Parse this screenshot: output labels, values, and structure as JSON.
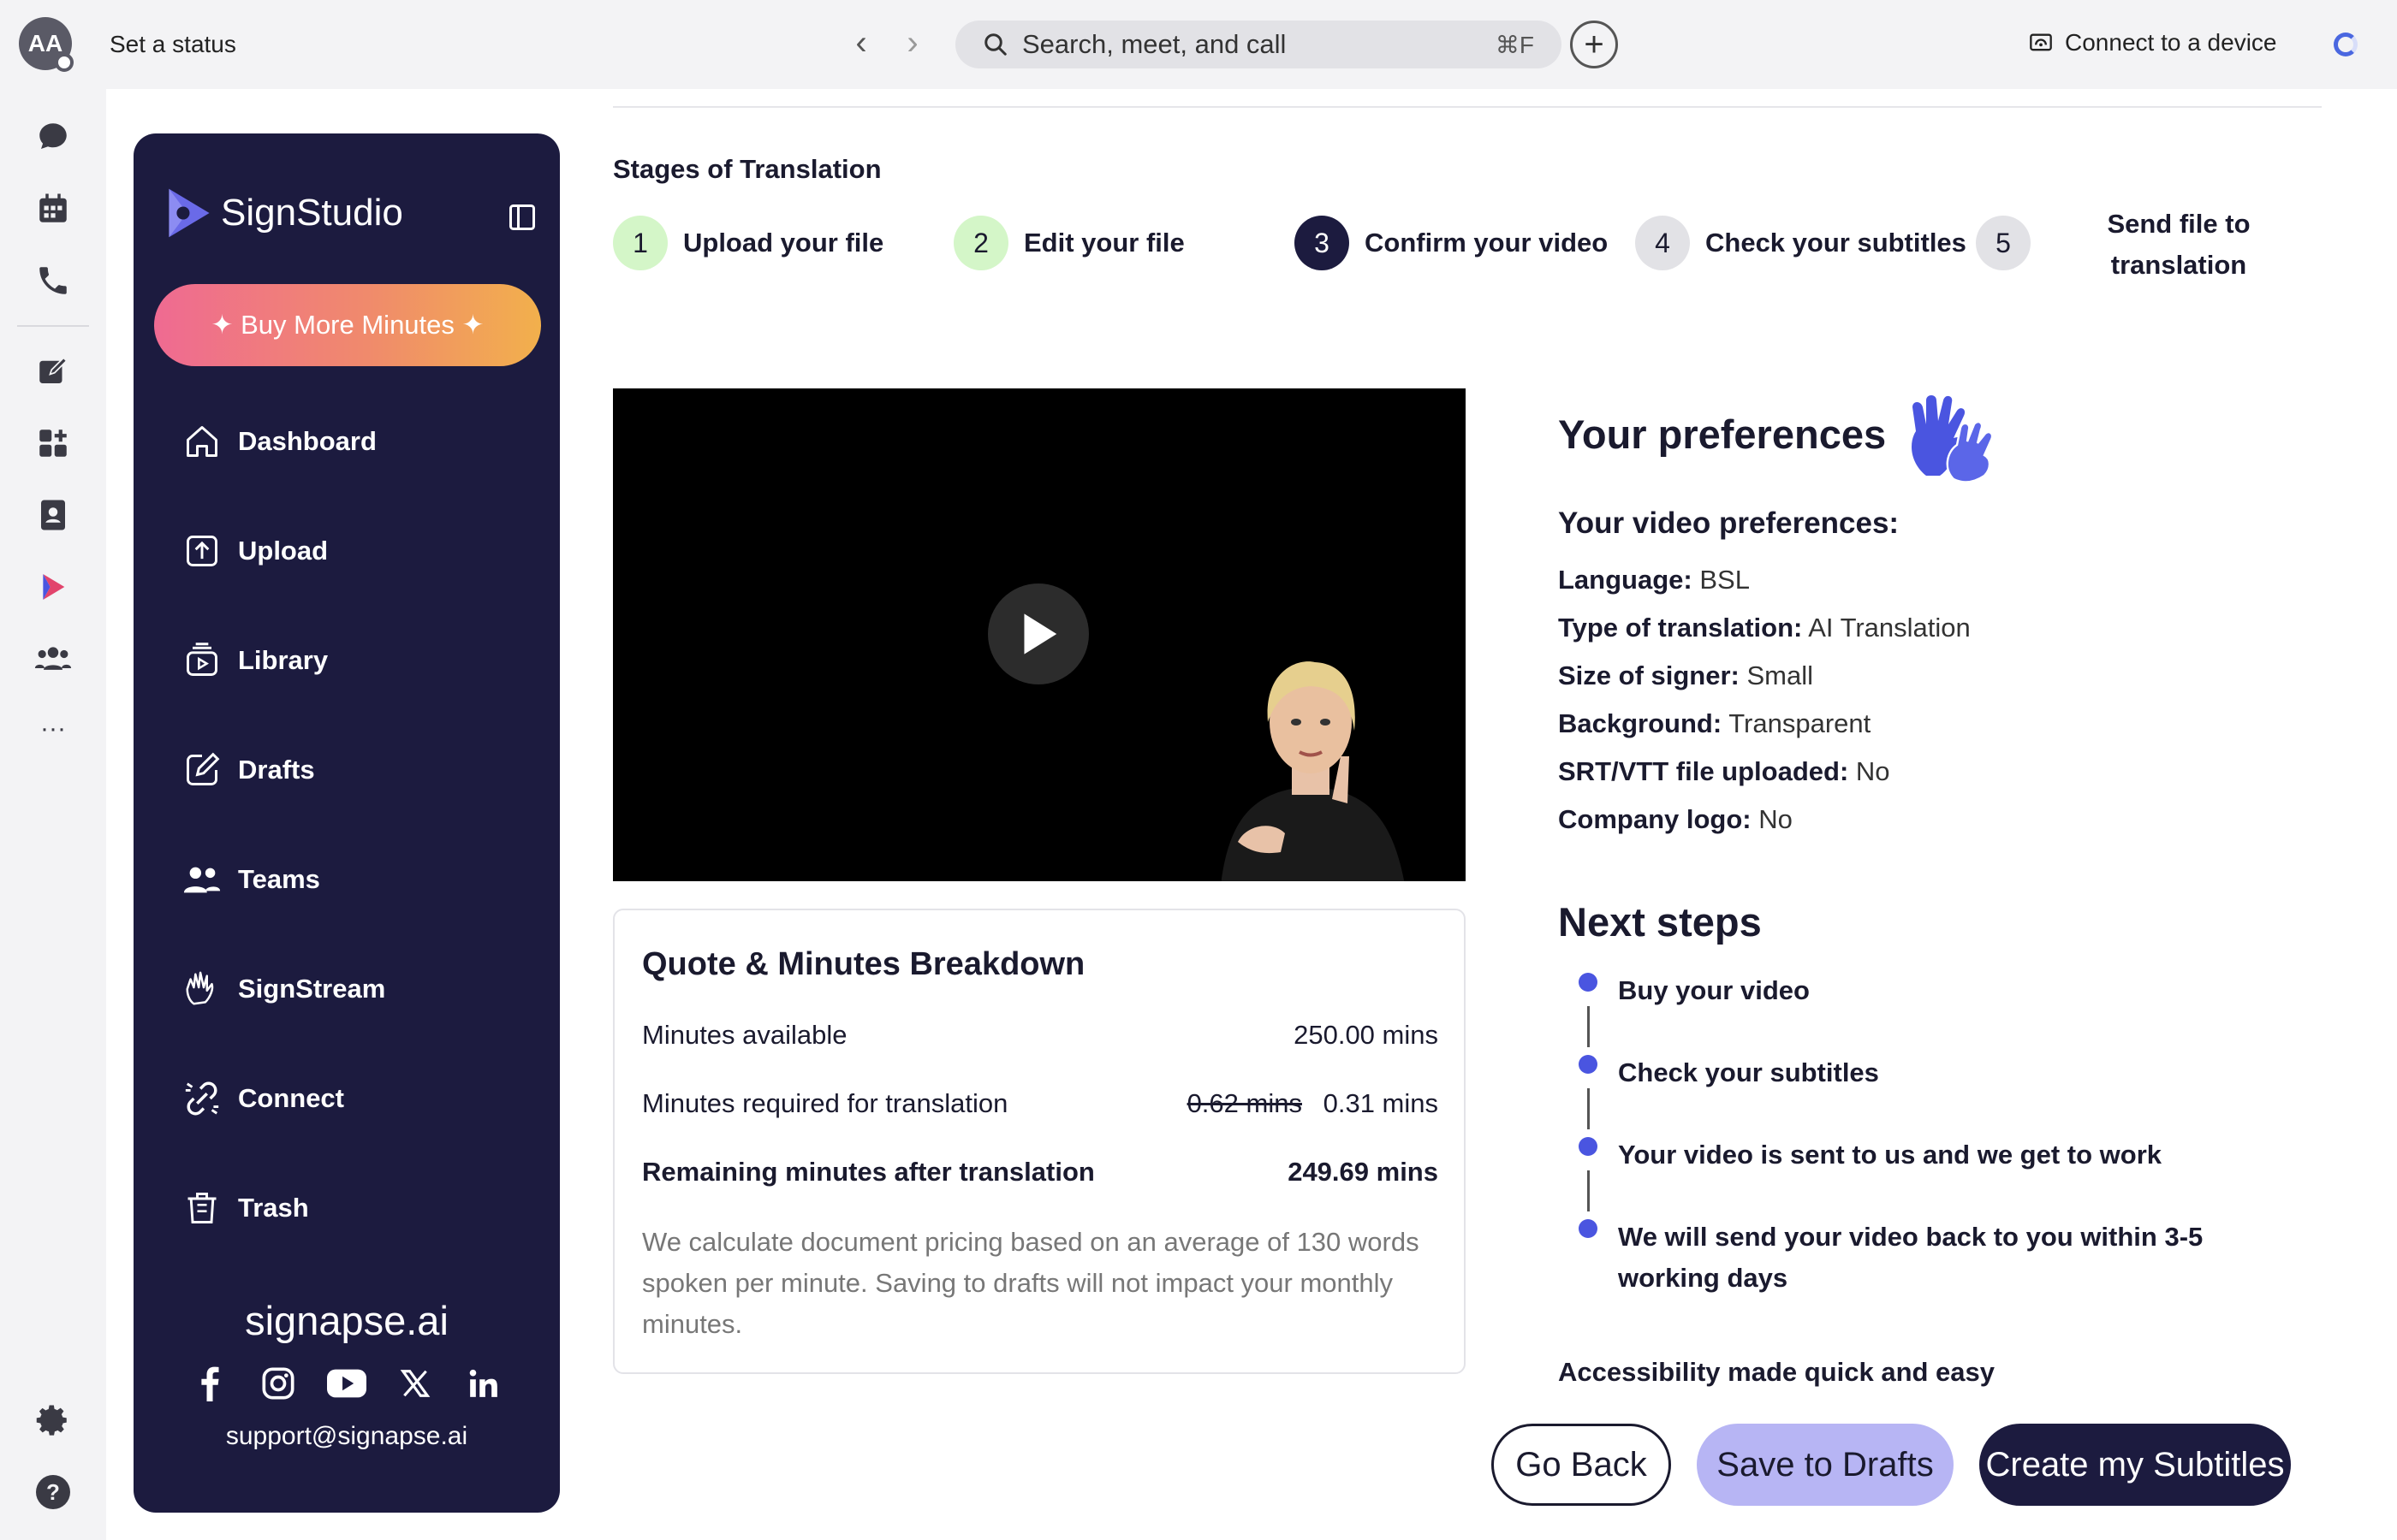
{
  "topbar": {
    "avatar_initials": "AA",
    "status_text": "Set a status",
    "back_glyph": "‹",
    "forward_glyph": "›",
    "search_placeholder": "Search, meet, and call",
    "search_shortcut": "⌘F",
    "add_glyph": "+",
    "connect_device": "Connect to a device"
  },
  "rail": {
    "icons": [
      "chat-icon",
      "calendar-icon",
      "phone-icon",
      "compose-icon",
      "apps-icon",
      "contacts-icon",
      "signstudio-app-icon",
      "people-icon",
      "more-icon",
      "settings-icon",
      "help-icon"
    ],
    "more_glyph": "···",
    "help_glyph": "?"
  },
  "sidebar": {
    "brand": "SignStudio",
    "buy_label": "✦ Buy More Minutes ✦",
    "items": [
      {
        "label": "Dashboard",
        "icon": "home-icon"
      },
      {
        "label": "Upload",
        "icon": "upload-icon"
      },
      {
        "label": "Library",
        "icon": "library-icon"
      },
      {
        "label": "Drafts",
        "icon": "drafts-icon"
      },
      {
        "label": "Teams",
        "icon": "teams-icon"
      },
      {
        "label": "SignStream",
        "icon": "signstream-icon"
      },
      {
        "label": "Connect",
        "icon": "connect-icon"
      },
      {
        "label": "Trash",
        "icon": "trash-icon"
      }
    ],
    "domain": "signapse.ai",
    "socials": [
      "facebook-icon",
      "instagram-icon",
      "youtube-icon",
      "x-icon",
      "linkedin-icon"
    ],
    "support_email": "support@signapse.ai"
  },
  "stages": {
    "title": "Stages of Translation",
    "items": [
      {
        "num": "1",
        "label": "Upload your file",
        "state": "done"
      },
      {
        "num": "2",
        "label": "Edit your file",
        "state": "done"
      },
      {
        "num": "3",
        "label": "Confirm your video",
        "state": "current"
      },
      {
        "num": "4",
        "label": "Check your subtitles",
        "state": "todo"
      },
      {
        "num": "5",
        "label": "Send file to translation",
        "state": "todo"
      }
    ]
  },
  "quote": {
    "title": "Quote & Minutes Breakdown",
    "available_label": "Minutes available",
    "available_value": "250.00 mins",
    "required_label": "Minutes required for translation",
    "required_old": "0.62 mins",
    "required_value": "0.31 mins",
    "remaining_label": "Remaining minutes after translation",
    "remaining_value": "249.69 mins",
    "note": "We calculate document pricing based on an average of 130 words spoken per minute. Saving to drafts will not impact your monthly minutes."
  },
  "preferences": {
    "title": "Your preferences",
    "subtitle": "Your video preferences:",
    "rows": [
      {
        "label": "Language:",
        "value": "BSL"
      },
      {
        "label": "Type of translation:",
        "value": "AI Translation"
      },
      {
        "label": "Size of signer:",
        "value": "Small"
      },
      {
        "label": "Background:",
        "value": "Transparent"
      },
      {
        "label": "SRT/VTT file uploaded:",
        "value": "No"
      },
      {
        "label": "Company logo:",
        "value": "No"
      }
    ]
  },
  "next_steps": {
    "title": "Next steps",
    "items": [
      "Buy your video",
      "Check your subtitles",
      "Your video is sent to us and we get to work",
      "We will send your video back to you within 3-5 working days"
    ],
    "tagline": "Accessibility made quick and easy"
  },
  "actions": {
    "back": "Go Back",
    "drafts": "Save to Drafts",
    "create": "Create my Subtitles"
  },
  "colors": {
    "sidebar_bg": "#1c1b3f",
    "accent_blue": "#4a55e0",
    "done_green": "#d4f6c8",
    "drafts_lavender": "#b7b5f4"
  }
}
